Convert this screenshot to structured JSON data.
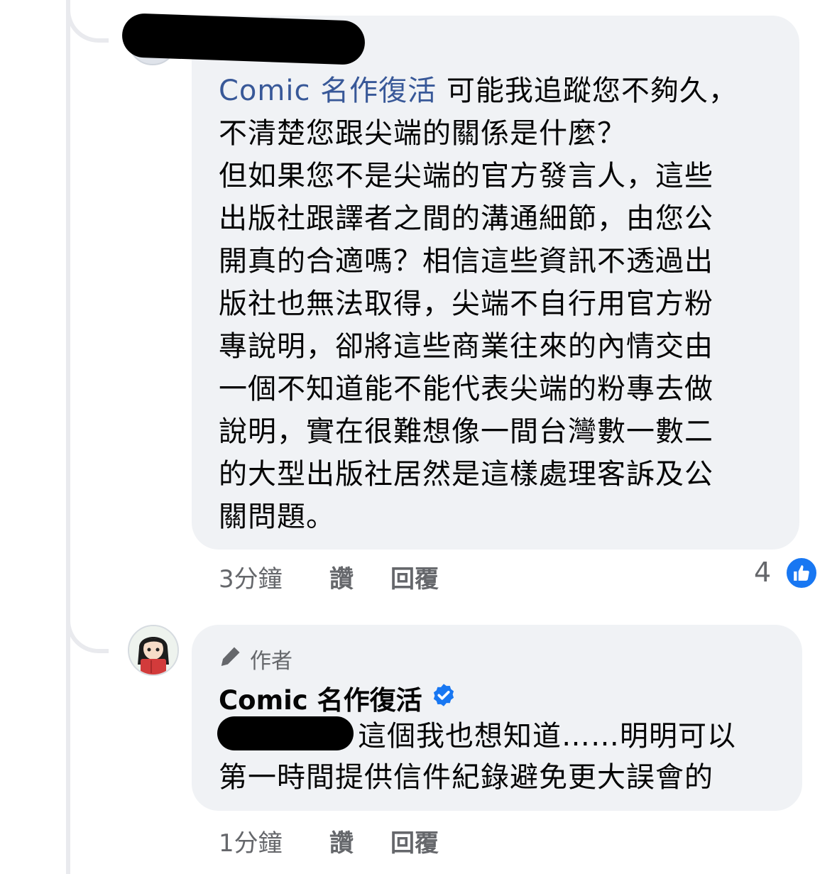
{
  "comment1": {
    "mention": "Comic 名作復活",
    "text_rest": " 可能我追蹤您不夠久，\n不清楚您跟尖端的關係是什麼？\n但如果您不是尖端的官方發言人，這些\n出版社跟譯者之間的溝通細節，由您公\n開真的合適嗎？相信這些資訊不透過出\n版社也無法取得，尖端不自行用官方粉\n專說明，卻將這些商業往來的內情交由\n一個不知道能不能代表尖端的粉專去做\n說明，實在很難想像一間台灣數一數二\n的大型出版社居然是這樣處理客訴及公\n關問題。",
    "time": "3分鐘",
    "like_label": "讚",
    "reply_label": "回覆",
    "reaction_count": "4",
    "reaction_icon": "thumbs-up-icon",
    "reaction_color": "#1877f2"
  },
  "comment2": {
    "author_badge": "作者",
    "author_badge_icon": "pencil-icon",
    "name": "Comic 名作復活",
    "verified_icon": "verified-badge-icon",
    "verified_color": "#1877f2",
    "text_line1": "這個我也想知道……明明可以",
    "text_line2": "第一時間提供信件紀錄避免更大誤會的",
    "time": "1分鐘",
    "like_label": "讚",
    "reply_label": "回覆"
  },
  "colors": {
    "bubble": "#f0f2f5",
    "meta_text": "#65676b",
    "mention": "#385898"
  }
}
